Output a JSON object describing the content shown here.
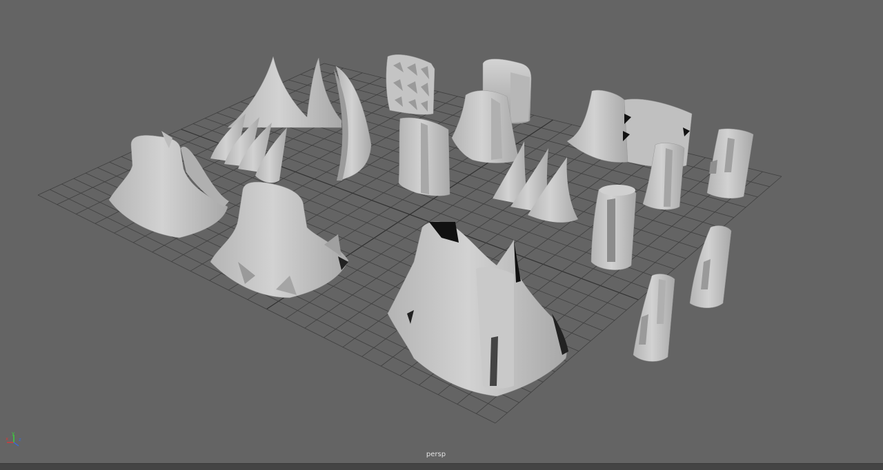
{
  "viewport": {
    "camera_label": "persp",
    "background_color": "#646464",
    "grid_color": "#3f3f3f",
    "grid_center_line_color": "#303030",
    "mesh_color": "#c8c8c8",
    "mesh_shadow_color": "#8a8a8a",
    "mesh_dark_color": "#1a1a1a"
  },
  "axis_gizmo": {
    "x_label": "x",
    "y_label": "y",
    "z_label": "z",
    "x_color": "#d23b3b",
    "y_color": "#3bd23b",
    "z_color": "#3b6ad2"
  }
}
